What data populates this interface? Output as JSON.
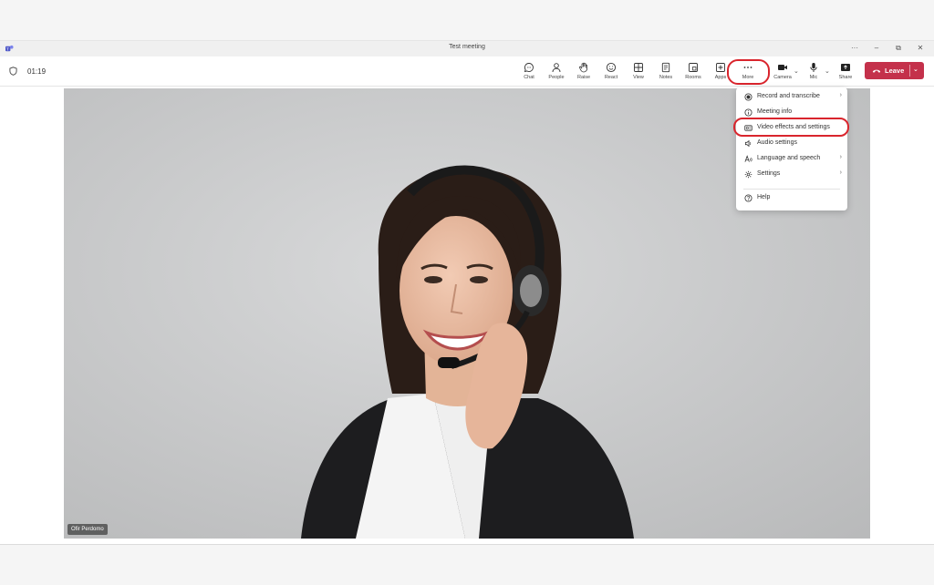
{
  "window": {
    "title": "Test meeting",
    "controls": [
      "···",
      "–",
      "⧉",
      "✕"
    ]
  },
  "toolbar": {
    "timer": "01:19",
    "buttons": [
      {
        "id": "chat",
        "label": "Chat",
        "icon": "chat-icon"
      },
      {
        "id": "people",
        "label": "People",
        "icon": "people-icon"
      },
      {
        "id": "raise",
        "label": "Raise",
        "icon": "hand-icon"
      },
      {
        "id": "react",
        "label": "React",
        "icon": "smiley-icon"
      },
      {
        "id": "view",
        "label": "View",
        "icon": "grid-icon"
      },
      {
        "id": "notes",
        "label": "Notes",
        "icon": "notes-icon"
      },
      {
        "id": "rooms",
        "label": "Rooms",
        "icon": "rooms-icon"
      },
      {
        "id": "apps",
        "label": "Apps",
        "icon": "plus-icon"
      },
      {
        "id": "more",
        "label": "More",
        "icon": "ellipsis-icon"
      },
      {
        "id": "camera",
        "label": "Camera",
        "icon": "camera-icon"
      },
      {
        "id": "mic",
        "label": "Mic",
        "icon": "mic-icon"
      },
      {
        "id": "share",
        "label": "Share",
        "icon": "share-icon"
      }
    ],
    "leave_label": "Leave"
  },
  "more_menu": {
    "items": [
      {
        "label": "Record and transcribe",
        "icon": "record-icon",
        "submenu": true
      },
      {
        "label": "Meeting info",
        "icon": "info-icon",
        "submenu": false
      },
      {
        "label": "Video effects and settings",
        "icon": "video-effects-icon",
        "submenu": false,
        "highlighted": true
      },
      {
        "label": "Audio settings",
        "icon": "audio-icon",
        "submenu": false
      },
      {
        "label": "Language and speech",
        "icon": "language-icon",
        "submenu": true
      },
      {
        "label": "Settings",
        "icon": "gear-icon",
        "submenu": true
      },
      {
        "label": "Help",
        "icon": "help-icon",
        "submenu": false
      }
    ]
  },
  "stage": {
    "participant_name": "Ofir Perdomo"
  },
  "colors": {
    "leave": "#c4314b",
    "highlight": "#d9252d",
    "stage_bg": "#c9cacb"
  }
}
